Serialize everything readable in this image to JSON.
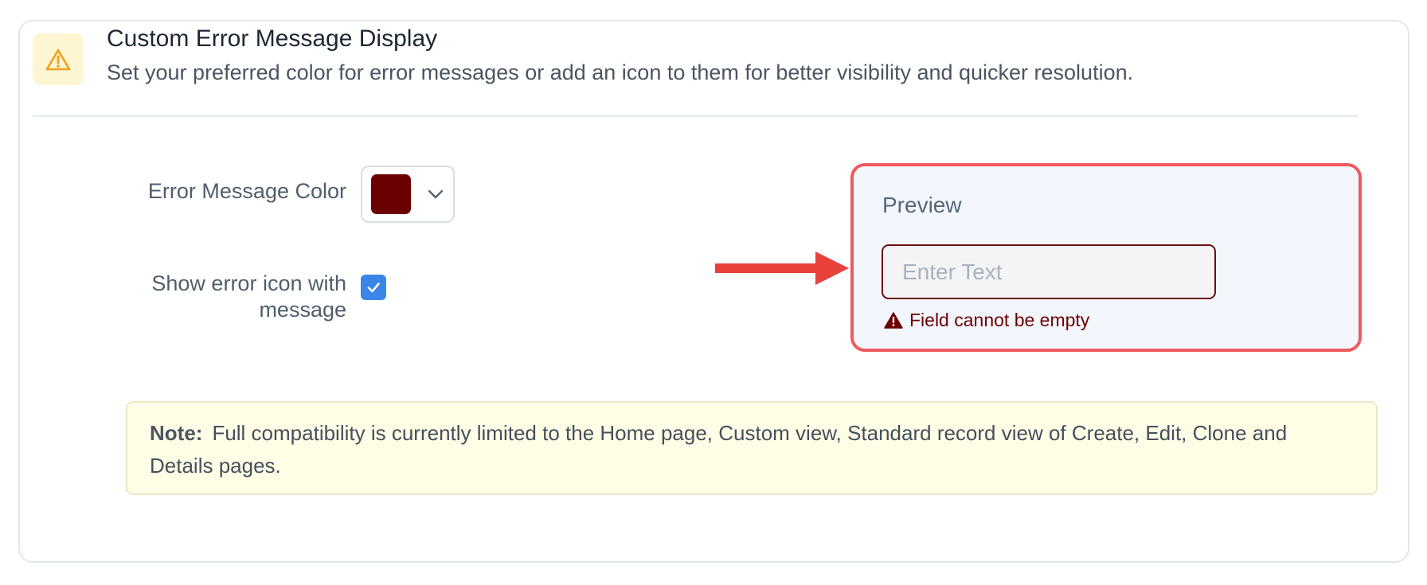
{
  "section": {
    "title": "Custom Error Message Display",
    "description": "Set your preferred color for error messages or add an icon to them for better visibility and quicker resolution.",
    "icon": "warning-triangle-icon"
  },
  "settings": {
    "color_label": "Error Message Color",
    "color_value": "#6b0000",
    "show_icon_label": "Show error icon with message",
    "show_icon_checked": true
  },
  "preview": {
    "title": "Preview",
    "input_placeholder": "Enter Text",
    "error_text": "Field cannot be empty",
    "error_color": "#6b0000"
  },
  "note": {
    "label": "Note:",
    "text": "Full compatibility is currently limited to the Home page, Custom view, Standard record view of Create, Edit, Clone and Details pages."
  },
  "colors": {
    "accent_blue": "#3a86e8",
    "highlight_red": "#ef5a5f",
    "warning_amber": "#f0a21b"
  }
}
